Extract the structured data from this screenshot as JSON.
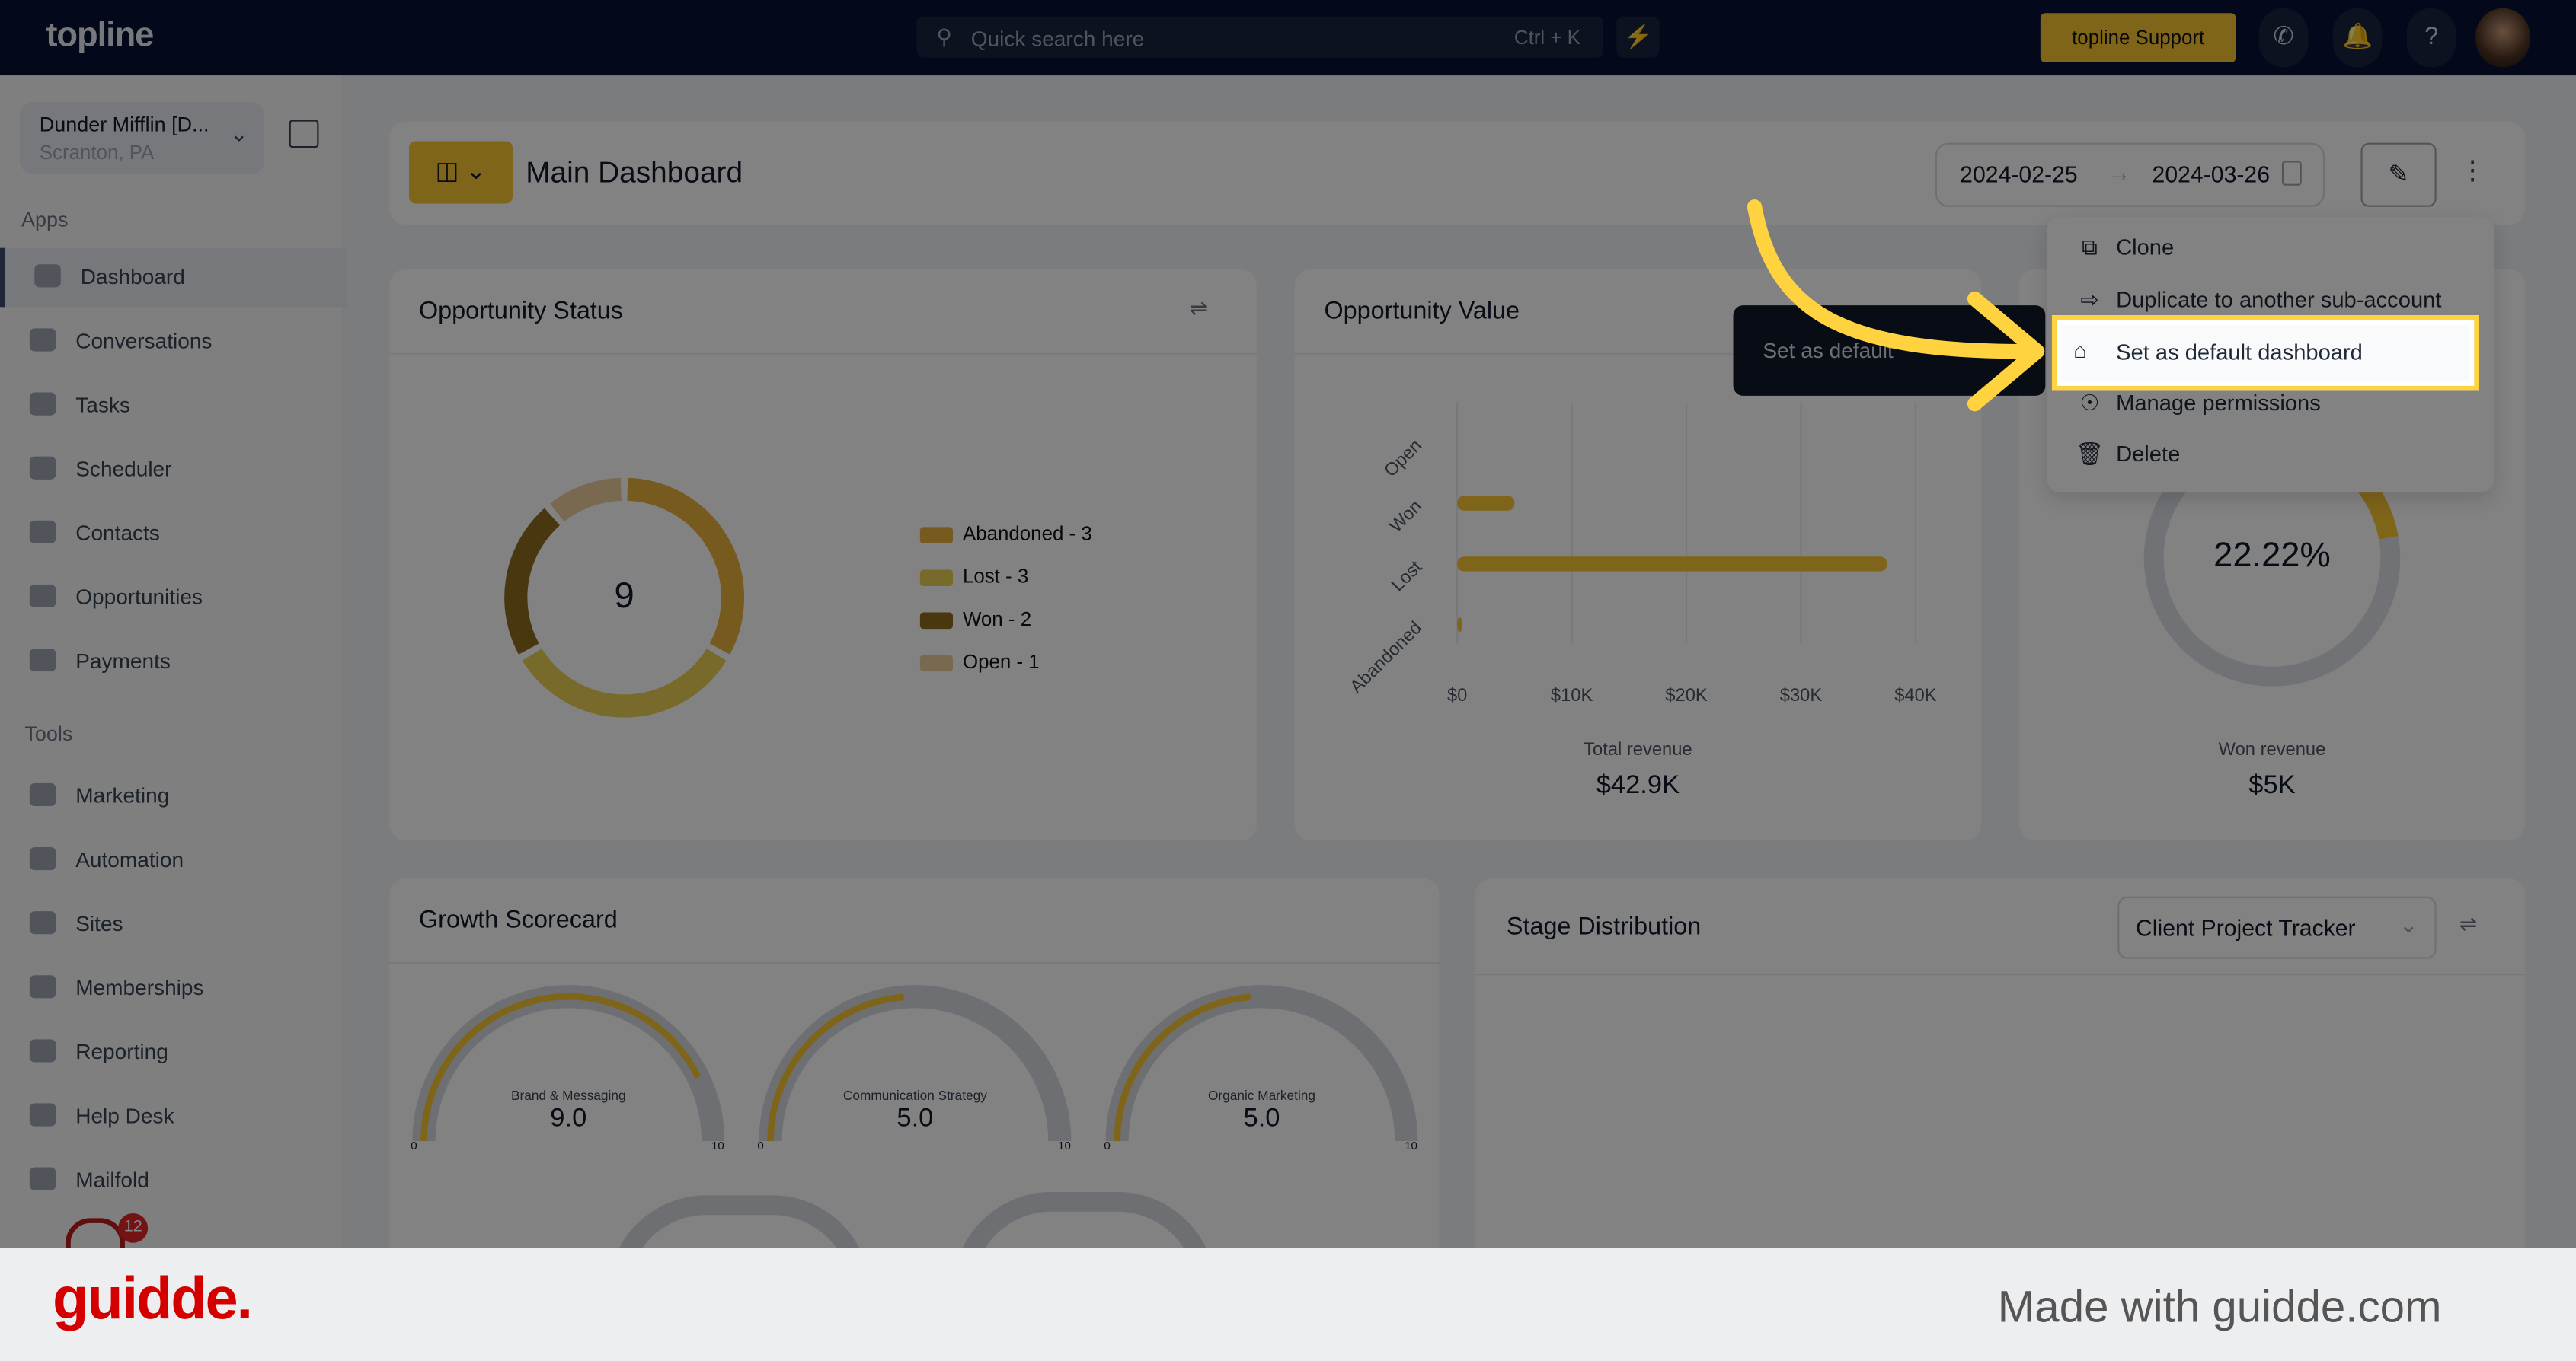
{
  "topbar": {
    "logo": "topline",
    "search_placeholder": "Quick search here",
    "search_shortcut": "Ctrl + K",
    "support_label": "topline Support",
    "icons": [
      "search-icon",
      "bolt-icon",
      "phone-icon",
      "bell-icon",
      "help-icon",
      "avatar"
    ]
  },
  "sidebar": {
    "account_name": "Dunder Mifflin [D...",
    "account_location": "Scranton, PA",
    "apps_label": "Apps",
    "tools_label": "Tools",
    "apps": [
      {
        "label": "Dashboard",
        "active": true
      },
      {
        "label": "Conversations"
      },
      {
        "label": "Tasks"
      },
      {
        "label": "Scheduler"
      },
      {
        "label": "Contacts"
      },
      {
        "label": "Opportunities"
      },
      {
        "label": "Payments"
      }
    ],
    "tools": [
      {
        "label": "Marketing"
      },
      {
        "label": "Automation"
      },
      {
        "label": "Sites"
      },
      {
        "label": "Memberships"
      },
      {
        "label": "Reporting"
      },
      {
        "label": "Help Desk"
      },
      {
        "label": "Mailfold"
      }
    ],
    "notification_badge": "12"
  },
  "header": {
    "title": "Main Dashboard",
    "date_start": "2024-02-25",
    "date_end": "2024-03-26"
  },
  "menu": {
    "items": [
      "Clone",
      "Duplicate to another sub-account",
      "Set as default dashboard",
      "Manage permissions",
      "Delete"
    ],
    "highlighted": "Set as default dashboard"
  },
  "tooltip": "Set as default",
  "cards": {
    "opportunity_status": {
      "title": "Opportunity Status",
      "total": "9",
      "legend": [
        "Abandoned - 3",
        "Lost - 3",
        "Won - 2",
        "Open - 1"
      ]
    },
    "opportunity_value": {
      "title": "Opportunity Value",
      "footer_label": "Total revenue",
      "footer_value": "$42.9K"
    },
    "conversion": {
      "percent": "22.22%",
      "footer_label": "Won revenue",
      "footer_value": "$5K"
    },
    "growth": {
      "title": "Growth Scorecard",
      "gauges": [
        {
          "label": "Brand & Messaging",
          "value": "9.0"
        },
        {
          "label": "Communication Strategy",
          "value": "5.0"
        },
        {
          "label": "Organic Marketing",
          "value": "5.0"
        }
      ],
      "min": "0",
      "max": "10"
    },
    "stage": {
      "title": "Stage Distribution",
      "select": "Client Project Tracker"
    }
  },
  "chart_data": [
    {
      "type": "pie",
      "title": "Opportunity Status",
      "categories": [
        "Abandoned",
        "Lost",
        "Won",
        "Open"
      ],
      "values": [
        3,
        3,
        2,
        1
      ],
      "colors": [
        "#e3ad3a",
        "#e6cc52",
        "#8b6a1e",
        "#e8c99a"
      ]
    },
    {
      "type": "bar",
      "orientation": "horizontal",
      "title": "Opportunity Value",
      "categories": [
        "Open",
        "Won",
        "Lost",
        "Abandoned"
      ],
      "values": [
        0,
        5000,
        37500,
        400
      ],
      "xticks": [
        "$0",
        "$10K",
        "$20K",
        "$30K",
        "$40K"
      ],
      "xlim": [
        0,
        40000
      ],
      "grid": true,
      "color": "#f2c230"
    },
    {
      "type": "pie",
      "values": [
        22.22,
        77.78
      ],
      "colors": [
        "#f2c230",
        "#d9dbe3"
      ]
    }
  ],
  "footer": {
    "brand": "guidde.",
    "made_with": "Made with guidde.com"
  }
}
